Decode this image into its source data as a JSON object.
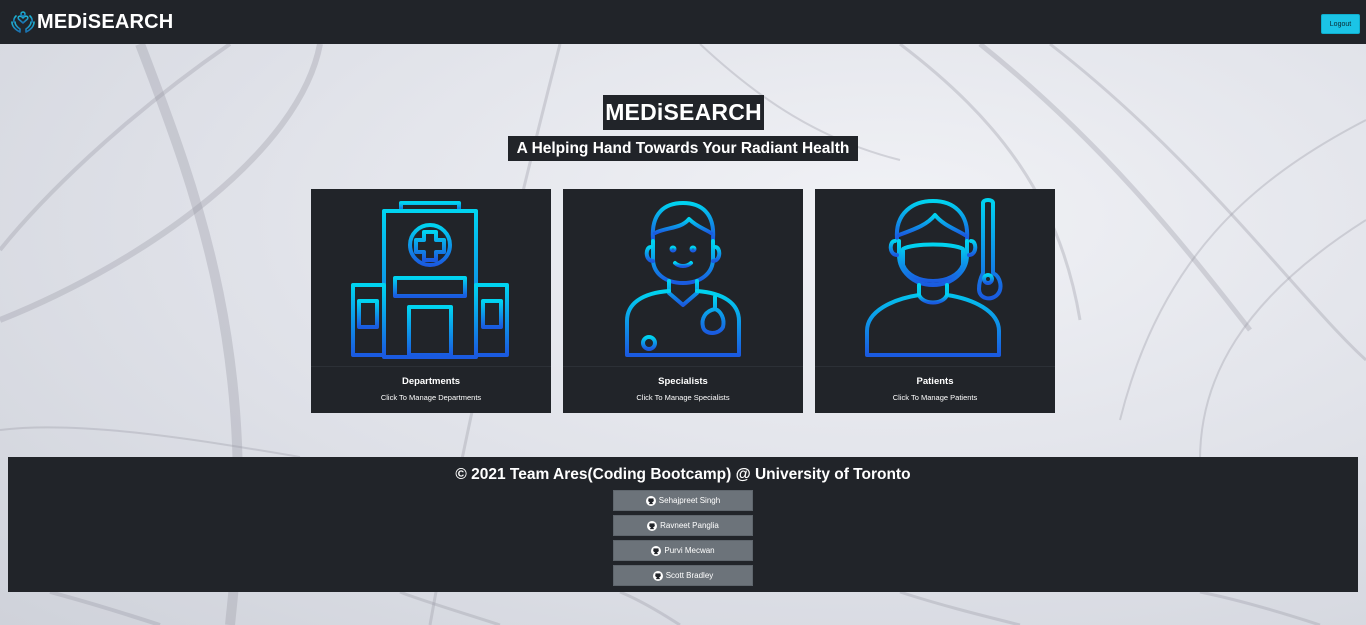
{
  "navbar": {
    "brand": "MEDiSEARCH",
    "logo_icon": "hands-heart-icon",
    "logout_label": "Logout"
  },
  "hero": {
    "title": "MEDiSEARCH",
    "subtitle": "A Helping Hand Towards Your Radiant Health"
  },
  "cards": [
    {
      "icon": "hospital-icon",
      "title": "Departments",
      "text": "Click To Manage Departments"
    },
    {
      "icon": "doctor-icon",
      "title": "Specialists",
      "text": "Click To Manage Specialists"
    },
    {
      "icon": "patient-icon",
      "title": "Patients",
      "text": "Click To Manage Patients"
    }
  ],
  "footer": {
    "copyright": "© 2021 Team Ares(Coding Bootcamp) @ University of Toronto",
    "members": [
      {
        "name": "Sehajpreet Singh",
        "icon": "github-icon"
      },
      {
        "name": "Ravneet Panglia",
        "icon": "github-icon"
      },
      {
        "name": "Purvi Mecwan",
        "icon": "github-icon"
      },
      {
        "name": "Scott Bradley",
        "icon": "github-icon"
      }
    ]
  },
  "colors": {
    "dark": "#212429",
    "accent": "#1bc4e6",
    "icon_gradient_top": "#00d4f0",
    "icon_gradient_bottom": "#1a5ae0",
    "member_button": "#6c737a"
  }
}
